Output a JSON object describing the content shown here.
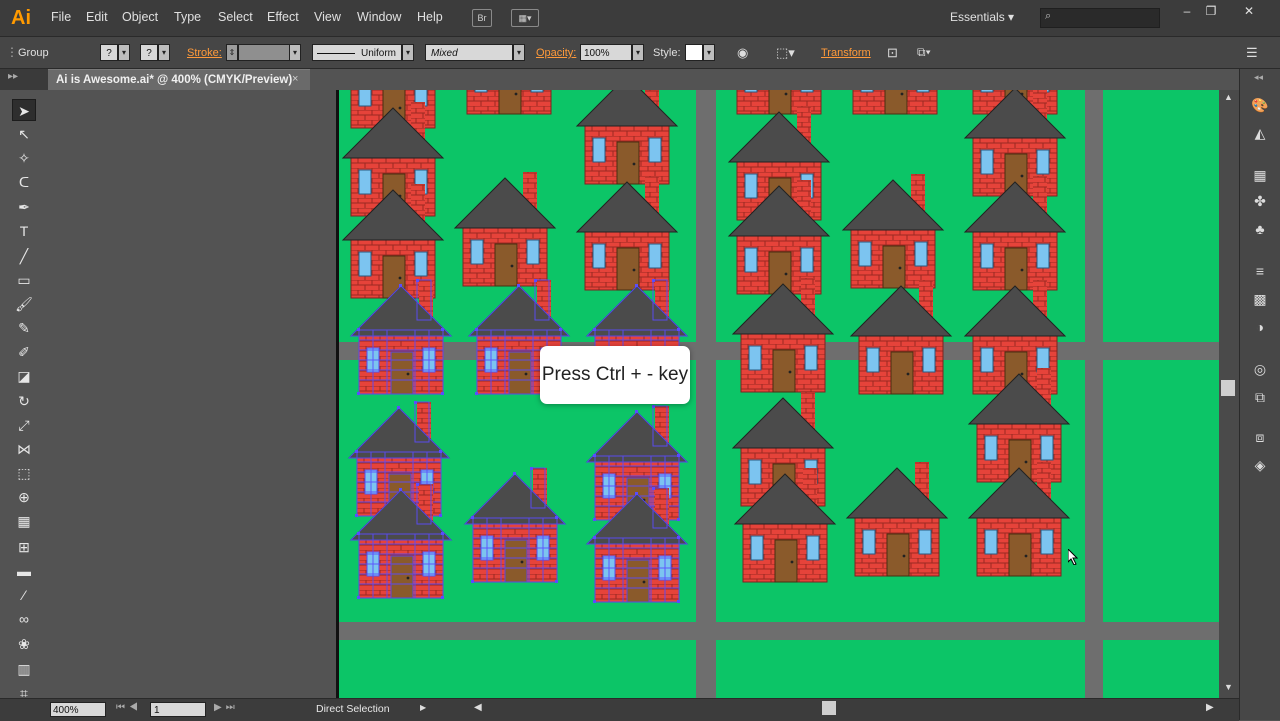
{
  "app": {
    "logo": "Ai"
  },
  "menu": [
    "File",
    "Edit",
    "Object",
    "Type",
    "Select",
    "Effect",
    "View",
    "Window",
    "Help"
  ],
  "menubar_icons": {
    "bridge": "Br",
    "arrange": "arrange-documents-icon"
  },
  "workspace": {
    "label": "Essentials"
  },
  "window_controls": [
    "–",
    "❐",
    "✕"
  ],
  "control_bar": {
    "selection_label": "Group",
    "fill_value": "?",
    "stroke_color_value": "?",
    "stroke_label": "Stroke:",
    "stroke_profile": "Uniform",
    "brush": "Mixed",
    "opacity_label": "Opacity:",
    "opacity_value": "100%",
    "style_label": "Style:",
    "transform_label": "Transform"
  },
  "document_tab": {
    "title": "Ai is Awesome.ai* @ 400% (CMYK/Preview)",
    "close": "×"
  },
  "status_bar": {
    "zoom": "400%",
    "artboard_number": "1",
    "tool_status": "Direct Selection"
  },
  "tooltip": {
    "text": "Press Ctrl + - key"
  },
  "colors": {
    "grass": "#0cc567",
    "road": "#6e6e6e",
    "brick": "#e6433a",
    "roof": "#4b4b4b",
    "door": "#8a5a2b",
    "window": "#7cc4f0",
    "selection": "#5a4cff",
    "accent_orange": "#ff9a3a"
  },
  "tools": [
    "selection-tool",
    "direct-selection-tool",
    "magic-wand-tool",
    "lasso-tool",
    "pen-tool",
    "type-tool",
    "line-segment-tool",
    "rectangle-tool",
    "paintbrush-tool",
    "pencil-tool",
    "blob-brush-tool",
    "eraser-tool",
    "rotate-tool",
    "scale-tool",
    "width-tool",
    "free-transform-tool",
    "shape-builder-tool",
    "perspective-grid-tool",
    "mesh-tool",
    "gradient-tool",
    "eyedropper-tool",
    "blend-tool",
    "symbol-sprayer-tool",
    "column-graph-tool",
    "artboard-tool"
  ],
  "right_panel": [
    "color-panel-icon",
    "color-guide-icon",
    "swatches-icon",
    "brushes-icon",
    "symbols-icon",
    "stroke-icon",
    "gradient-icon",
    "transparency-icon",
    "appearance-icon",
    "graphic-styles-icon",
    "align-icon",
    "layers-icon"
  ]
}
